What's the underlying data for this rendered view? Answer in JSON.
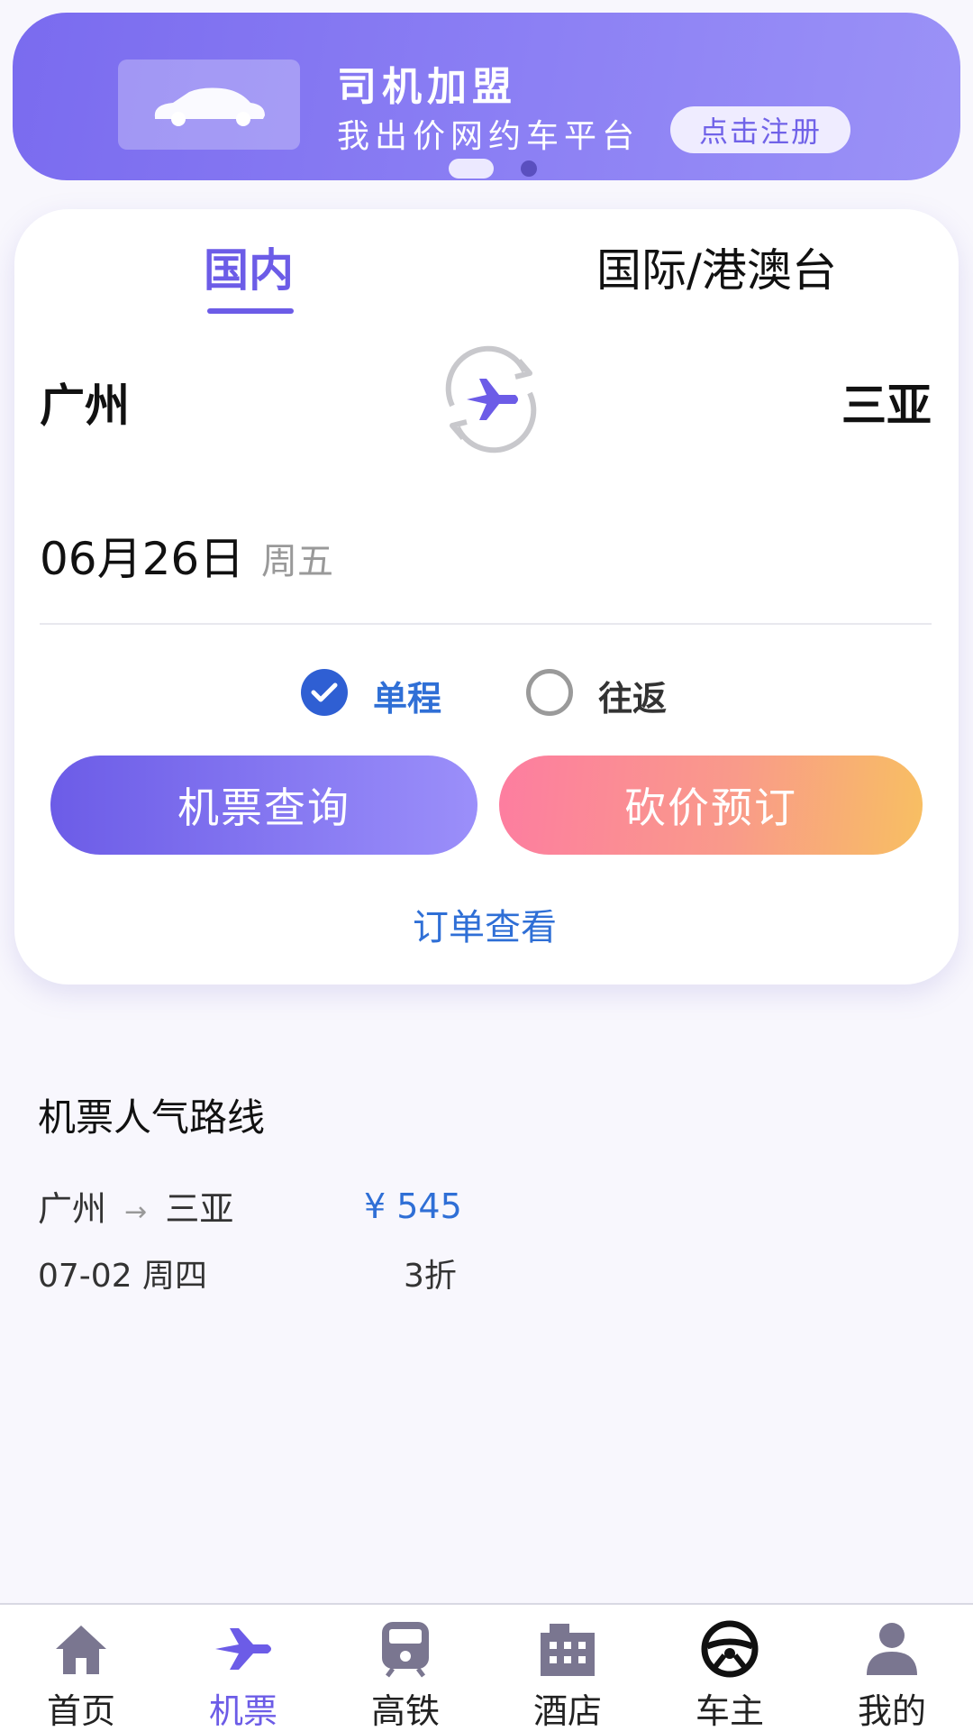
{
  "banner": {
    "title": "司机加盟",
    "subtitle": "我出价网约车平台",
    "cta": "点击注册"
  },
  "tabs": [
    {
      "label": "国内",
      "active": true
    },
    {
      "label": "国际/港澳台",
      "active": false
    }
  ],
  "route": {
    "from": "广州",
    "to": "三亚"
  },
  "date": {
    "value": "06月26日",
    "weekday": "周五"
  },
  "trip_type": {
    "options": [
      {
        "label": "单程",
        "selected": true
      },
      {
        "label": "往返",
        "selected": false
      }
    ]
  },
  "actions": {
    "search": "机票查询",
    "bargain": "砍价预订",
    "orders": "订单查看"
  },
  "popular": {
    "title": "机票人气路线",
    "routes": [
      {
        "from": "广州",
        "arrow": "→",
        "to": "三亚",
        "price": "¥ 545",
        "date": "07-02 周四",
        "discount": "3折"
      }
    ]
  },
  "nav": {
    "items": [
      {
        "label": "首页",
        "icon": "home-icon",
        "active": false
      },
      {
        "label": "机票",
        "icon": "plane-icon",
        "active": true
      },
      {
        "label": "高铁",
        "icon": "train-icon",
        "active": false
      },
      {
        "label": "酒店",
        "icon": "hotel-icon",
        "active": false
      },
      {
        "label": "车主",
        "icon": "steering-wheel-icon",
        "active": false
      },
      {
        "label": "我的",
        "icon": "user-icon",
        "active": false
      }
    ]
  },
  "colors": {
    "accent": "#6c5ce7",
    "link": "#2f6fd6",
    "bargain_start": "#fd7da0",
    "bargain_end": "#f8bf62"
  }
}
